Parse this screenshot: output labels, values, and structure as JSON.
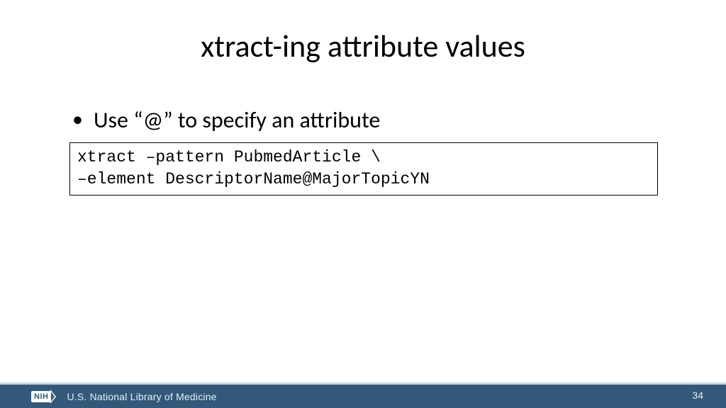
{
  "slide": {
    "title": "xtract-ing attribute values",
    "bullet": "Use “@” to specify an attribute",
    "code_line1": "xtract –pattern PubmedArticle \\",
    "code_line2": "–element DescriptorName@MajorTopicYN"
  },
  "footer": {
    "logo_text": "NIH",
    "org": "U.S. National Library of Medicine",
    "page_number": "34"
  }
}
